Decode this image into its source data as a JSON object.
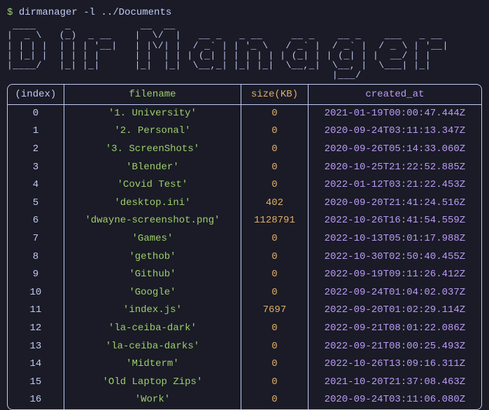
{
  "prompt": {
    "symbol": "$",
    "command": "dirmanager -l ../Documents"
  },
  "ascii_art": " ____     _            __  __                                                \n|  _ \\   (_)  _ __    |  \\/  |   __ _   _ __     __ _    __ _    ___   _ __  \n| | | |  | | | '__|   | |\\/| |  / _` | | '_ \\   / _` |  / _` |  / _ \\ | '__| \n| |_| |  | | | |      | |  | | | (_| | | | | | | (_| | | (_| | |  __/ | |    \n|____/   |_| |_|      |_|  |_|  \\__,_| |_| |_|  \\__,_|  \\__, |  \\___| |_|    \n                                                        |___/                ",
  "table": {
    "headers": {
      "index": "(index)",
      "filename": "filename",
      "size": "size(KB)",
      "created_at": "created_at"
    },
    "rows": [
      {
        "index": "0",
        "filename": "'1. University'",
        "size": "0",
        "created_at": "2021-01-19T00:00:47.444Z"
      },
      {
        "index": "1",
        "filename": "'2. Personal'",
        "size": "0",
        "created_at": "2020-09-24T03:11:13.347Z"
      },
      {
        "index": "2",
        "filename": "'3. ScreenShots'",
        "size": "0",
        "created_at": "2020-09-26T05:14:33.060Z"
      },
      {
        "index": "3",
        "filename": "'Blender'",
        "size": "0",
        "created_at": "2020-10-25T21:22:52.885Z"
      },
      {
        "index": "4",
        "filename": "'Covid Test'",
        "size": "0",
        "created_at": "2022-01-12T03:21:22.453Z"
      },
      {
        "index": "5",
        "filename": "'desktop.ini'",
        "size": "402",
        "created_at": "2020-09-20T21:41:24.516Z"
      },
      {
        "index": "6",
        "filename": "'dwayne-screenshot.png'",
        "size": "1128791",
        "created_at": "2022-10-26T16:41:54.559Z"
      },
      {
        "index": "7",
        "filename": "'Games'",
        "size": "0",
        "created_at": "2022-10-13T05:01:17.988Z"
      },
      {
        "index": "8",
        "filename": "'gethob'",
        "size": "0",
        "created_at": "2022-10-30T02:50:40.455Z"
      },
      {
        "index": "9",
        "filename": "'Github'",
        "size": "0",
        "created_at": "2022-09-19T09:11:26.412Z"
      },
      {
        "index": "10",
        "filename": "'Google'",
        "size": "0",
        "created_at": "2022-09-24T01:04:02.037Z"
      },
      {
        "index": "11",
        "filename": "'index.js'",
        "size": "7697",
        "created_at": "2022-09-20T01:02:29.114Z"
      },
      {
        "index": "12",
        "filename": "'la-ceiba-dark'",
        "size": "0",
        "created_at": "2022-09-21T08:01:22.086Z"
      },
      {
        "index": "13",
        "filename": "'la-ceiba-darks'",
        "size": "0",
        "created_at": "2022-09-21T08:00:25.493Z"
      },
      {
        "index": "14",
        "filename": "'Midterm'",
        "size": "0",
        "created_at": "2022-10-26T13:09:16.311Z"
      },
      {
        "index": "15",
        "filename": "'Old Laptop Zips'",
        "size": "0",
        "created_at": "2021-10-20T21:37:08.463Z"
      },
      {
        "index": "16",
        "filename": "'Work'",
        "size": "0",
        "created_at": "2020-09-24T03:11:06.080Z"
      }
    ]
  }
}
